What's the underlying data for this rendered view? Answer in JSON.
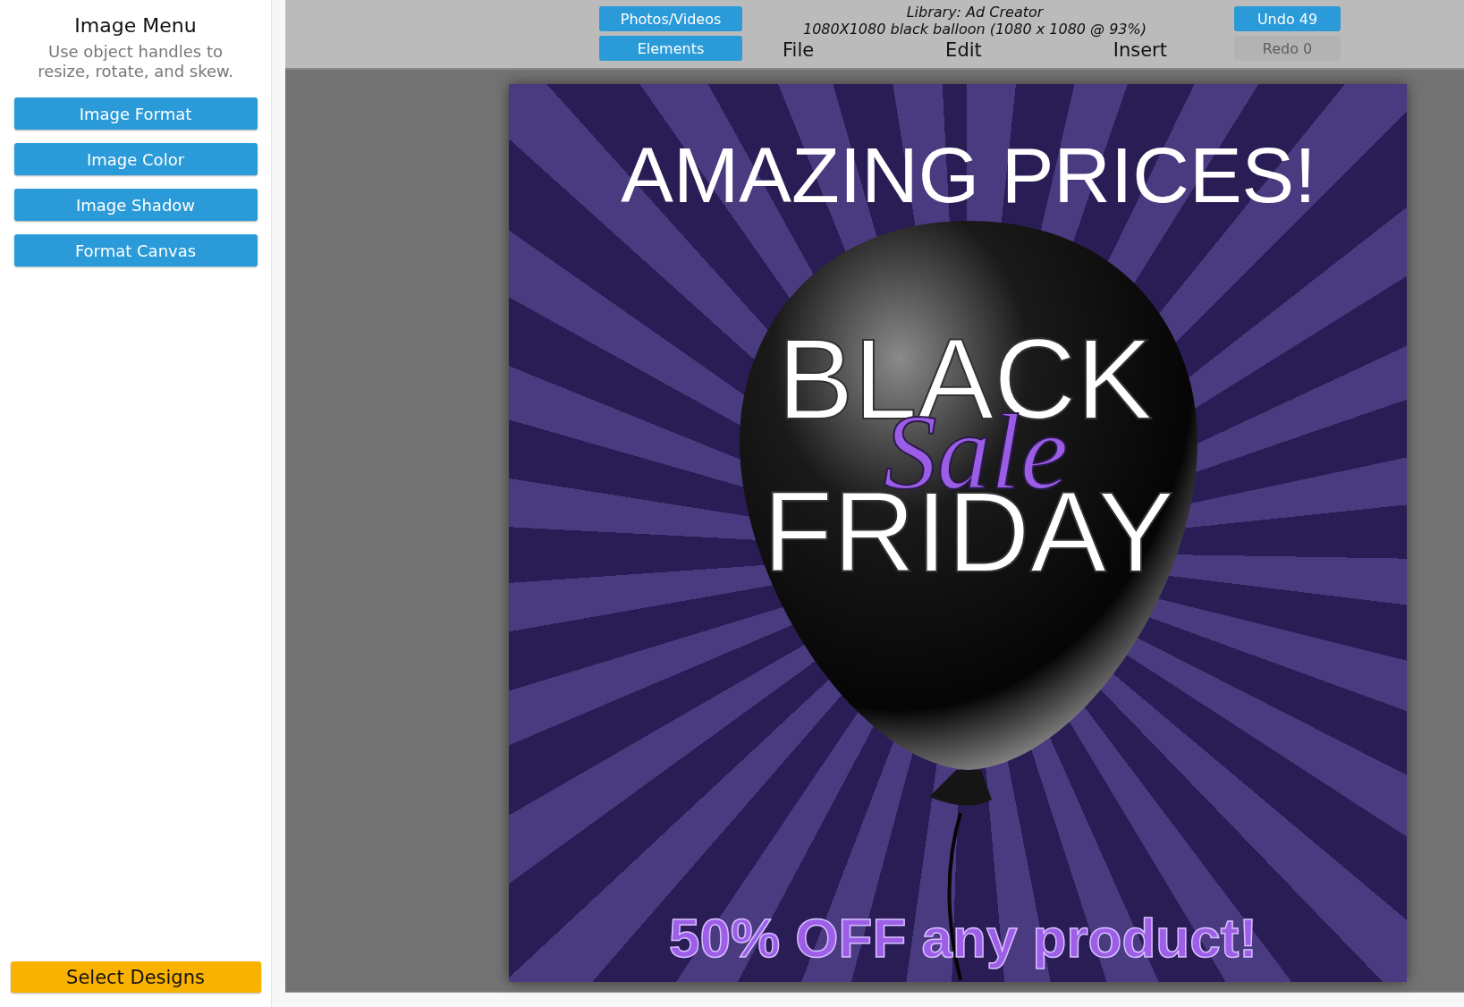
{
  "sidebar": {
    "title": "Image Menu",
    "hint": "Use object handles to resize, rotate, and skew.",
    "buttons": [
      "Image Format",
      "Image Color",
      "Image Shadow",
      "Format Canvas"
    ],
    "bottom_button": "Select Designs"
  },
  "toolbar": {
    "left_buttons": [
      "Photos/Videos",
      "Elements"
    ],
    "title": "Library: Ad Creator",
    "subtitle": "1080X1080 black balloon (1080 x 1080 @ 93%)",
    "menu": [
      "File",
      "Edit",
      "Insert"
    ],
    "history": [
      {
        "label": "Undo 49",
        "disabled": false
      },
      {
        "label": "Redo 0",
        "disabled": true
      }
    ]
  },
  "poster": {
    "headline": "AMAZING PRICES!",
    "title_top": "BLACK",
    "script": "Sale",
    "title_bottom": "FRIDAY",
    "offer": "50% OFF any product!"
  }
}
